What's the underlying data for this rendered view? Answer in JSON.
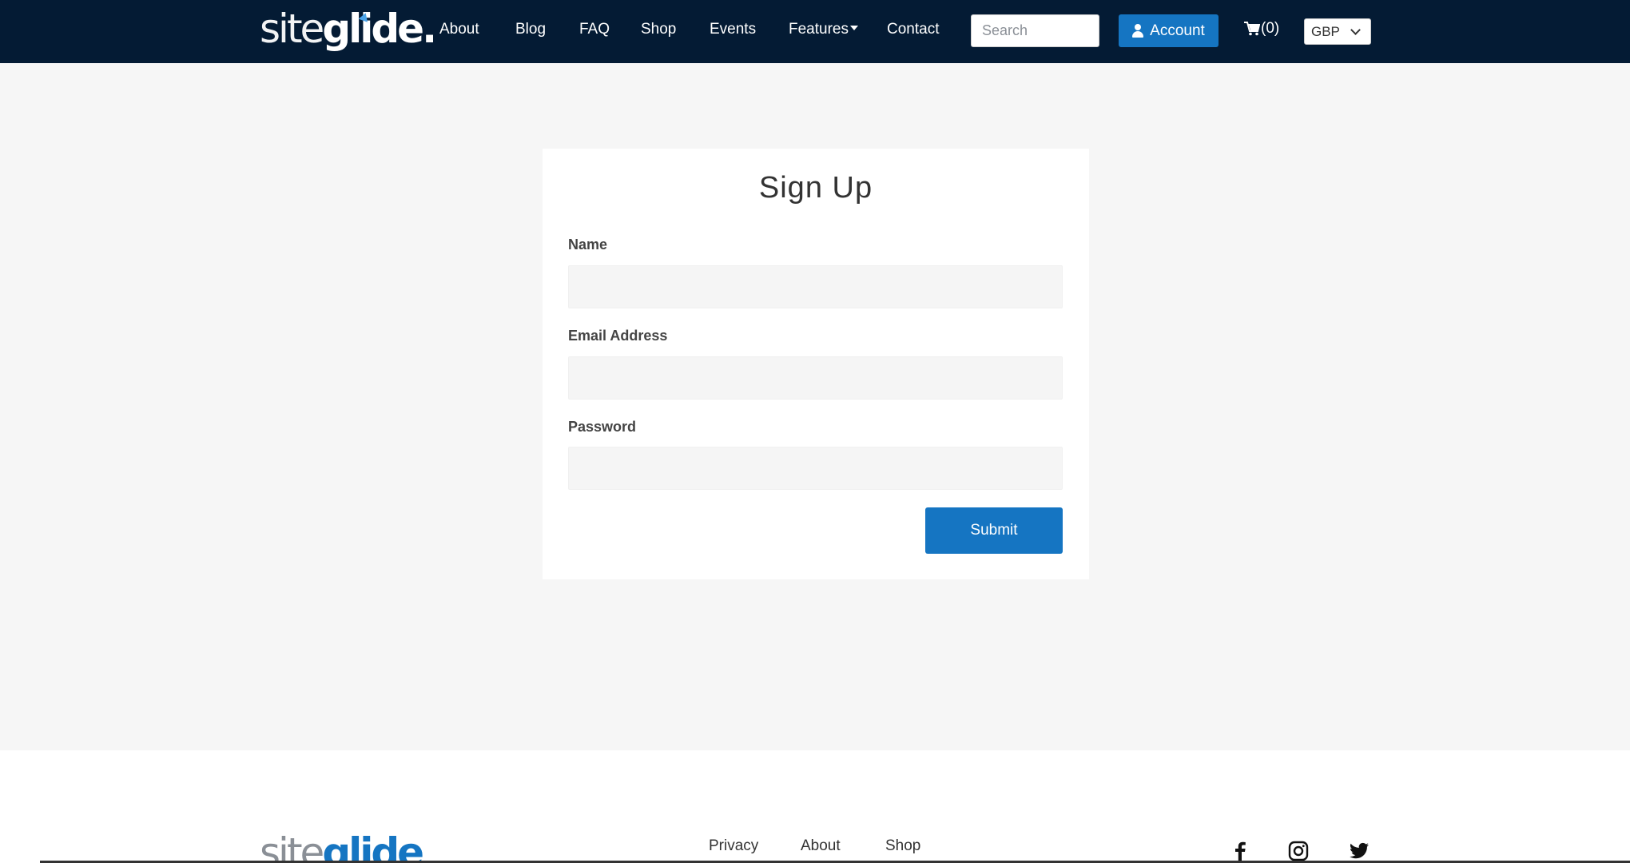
{
  "header": {
    "logo_text_thin": "site",
    "logo_text_bold": "glide",
    "logo_dot": ".",
    "nav": [
      "About",
      "Blog",
      "FAQ",
      "Shop",
      "Events",
      "Features",
      "Contact"
    ],
    "search_placeholder": "Search",
    "account_label": "Account",
    "cart_label": "(0)",
    "currency": "GBP"
  },
  "form": {
    "title": "Sign Up",
    "name_label": "Name",
    "email_label": "Email Address",
    "password_label": "Password",
    "submit_label": "Submit"
  },
  "footer": {
    "logo_text_thin": "site",
    "logo_text_bold": "glide",
    "links": [
      "Privacy",
      "About",
      "Shop"
    ],
    "social": [
      "facebook-icon",
      "instagram-icon",
      "twitter-icon"
    ]
  },
  "colors": {
    "navbar": "#041b34",
    "accent": "#1575c2",
    "page_bg": "#f6f6f6"
  }
}
